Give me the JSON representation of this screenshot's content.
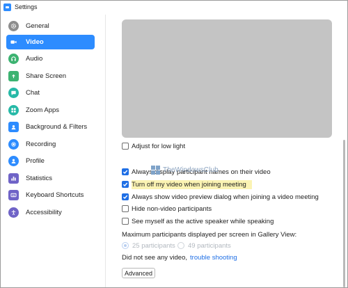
{
  "window": {
    "title": "Settings"
  },
  "sidebar": {
    "items": [
      {
        "label": "General",
        "icon": "gear-icon",
        "color": "#8d8d8d",
        "active": false
      },
      {
        "label": "Video",
        "icon": "video-camera-icon",
        "color": "#ffffff",
        "active": true
      },
      {
        "label": "Audio",
        "icon": "headphones-icon",
        "color": "#3cb371",
        "active": false
      },
      {
        "label": "Share Screen",
        "icon": "share-screen-icon",
        "color": "#3cb371",
        "active": false
      },
      {
        "label": "Chat",
        "icon": "chat-bubble-icon",
        "color": "#26b9a7",
        "active": false
      },
      {
        "label": "Zoom Apps",
        "icon": "apps-icon",
        "color": "#26b9a7",
        "active": false
      },
      {
        "label": "Background & Filters",
        "icon": "portrait-icon",
        "color": "#2d8cff",
        "active": false
      },
      {
        "label": "Recording",
        "icon": "record-icon",
        "color": "#2d8cff",
        "active": false
      },
      {
        "label": "Profile",
        "icon": "user-icon",
        "color": "#2d8cff",
        "active": false
      },
      {
        "label": "Statistics",
        "icon": "bar-chart-icon",
        "color": "#6f63c7",
        "active": false
      },
      {
        "label": "Keyboard Shortcuts",
        "icon": "keyboard-icon",
        "color": "#6f63c7",
        "active": false
      },
      {
        "label": "Accessibility",
        "icon": "accessibility-icon",
        "color": "#6f63c7",
        "active": false
      }
    ]
  },
  "video": {
    "options": [
      {
        "label": "Adjust for low light",
        "checked": false,
        "highlighted": false
      },
      {
        "label": "Always display participant names on their video",
        "checked": true,
        "highlighted": false
      },
      {
        "label": "Turn off my video when joining meeting",
        "checked": true,
        "highlighted": true
      },
      {
        "label": "Always show video preview dialog when joining a video meeting",
        "checked": true,
        "highlighted": false
      },
      {
        "label": "Hide non-video participants",
        "checked": false,
        "highlighted": false
      },
      {
        "label": "See myself as the active speaker while speaking",
        "checked": false,
        "highlighted": false
      }
    ],
    "gallery_label": "Maximum participants displayed per screen in Gallery View:",
    "gallery_options": [
      {
        "label": "25 participants",
        "selected": true
      },
      {
        "label": "49 participants",
        "selected": false
      }
    ],
    "no_video_text": "Did not see any video,",
    "trouble_link": "trouble shooting",
    "advanced_button": "Advanced"
  },
  "watermark": {
    "text": "TheWindowsClub"
  },
  "colors": {
    "accent": "#2d8cff",
    "checkbox": "#1f6fe5",
    "highlight": "#fbf3b3"
  }
}
